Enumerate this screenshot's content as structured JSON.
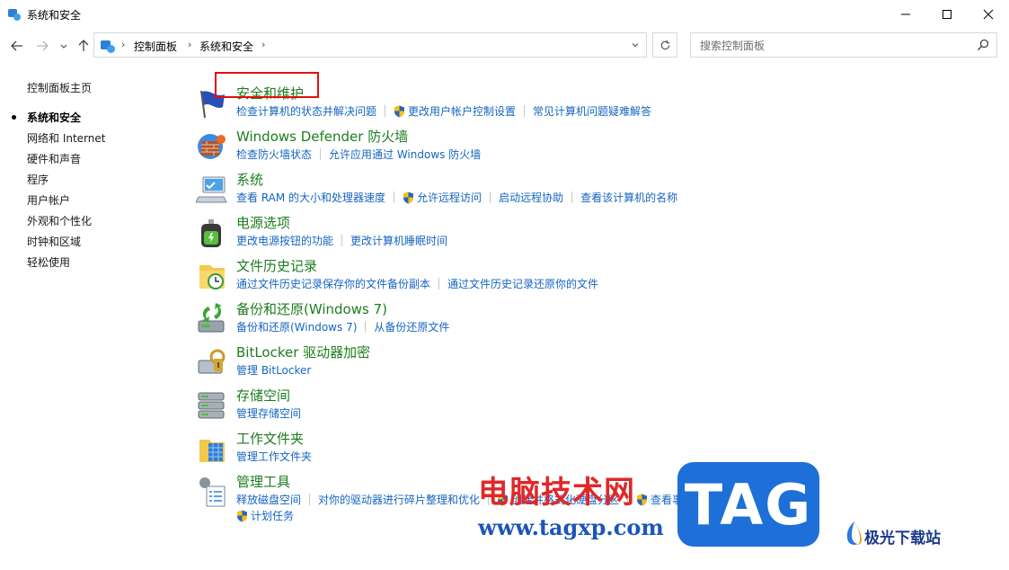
{
  "window": {
    "title": "系统和安全"
  },
  "nav": {
    "breadcrumb": [
      "控制面板",
      "系统和安全"
    ]
  },
  "search": {
    "placeholder": "搜索控制面板",
    "value": ""
  },
  "sidebar": {
    "items": [
      {
        "label": "控制面板主页",
        "current": false
      },
      {
        "label": "系统和安全",
        "current": true
      },
      {
        "label": "网络和 Internet",
        "current": false
      },
      {
        "label": "硬件和声音",
        "current": false
      },
      {
        "label": "程序",
        "current": false
      },
      {
        "label": "用户帐户",
        "current": false
      },
      {
        "label": "外观和个性化",
        "current": false
      },
      {
        "label": "时钟和区域",
        "current": false
      },
      {
        "label": "轻松使用",
        "current": false
      }
    ]
  },
  "categories": [
    {
      "title": "安全和维护",
      "icon": "flag-icon",
      "links": [
        "检查计算机的状态并解决问题",
        "更改用户帐户控制设置",
        "常见计算机问题疑难解答"
      ]
    },
    {
      "title": "Windows Defender 防火墙",
      "icon": "firewall-icon",
      "links": [
        "检查防火墙状态",
        "允许应用通过 Windows 防火墙"
      ]
    },
    {
      "title": "系统",
      "icon": "computer-icon",
      "links": [
        "查看 RAM 的大小和处理器速度",
        "允许远程访问",
        "启动远程协助",
        "查看该计算机的名称"
      ]
    },
    {
      "title": "电源选项",
      "icon": "power-icon",
      "links": [
        "更改电源按钮的功能",
        "更改计算机睡眠时间"
      ]
    },
    {
      "title": "文件历史记录",
      "icon": "file-history-icon",
      "links": [
        "通过文件历史记录保存你的文件备份副本",
        "通过文件历史记录还原你的文件"
      ]
    },
    {
      "title": "备份和还原(Windows 7)",
      "icon": "backup-icon",
      "links": [
        "备份和还原(Windows 7)",
        "从备份还原文件"
      ]
    },
    {
      "title": "BitLocker 驱动器加密",
      "icon": "bitlocker-icon",
      "links": [
        "管理 BitLocker"
      ]
    },
    {
      "title": "存储空间",
      "icon": "storage-icon",
      "links": [
        "管理存储空间"
      ]
    },
    {
      "title": "工作文件夹",
      "icon": "work-folders-icon",
      "links": [
        "管理工作文件夹"
      ]
    },
    {
      "title": "管理工具",
      "icon": "admin-tools-icon",
      "links": [
        "释放磁盘空间",
        "对你的驱动器进行碎片整理和优化",
        "创建并格式化硬盘分区",
        "查看事件日志",
        "计划任务"
      ]
    }
  ],
  "watermark": {
    "cn": "电脑技术网",
    "url": "www.tagxp.com",
    "tag": "TAG",
    "site": "极光下载站"
  },
  "colors": {
    "title_green": "#1e7d1e",
    "link_blue": "#1565c0",
    "highlight_red": "#e01010"
  }
}
